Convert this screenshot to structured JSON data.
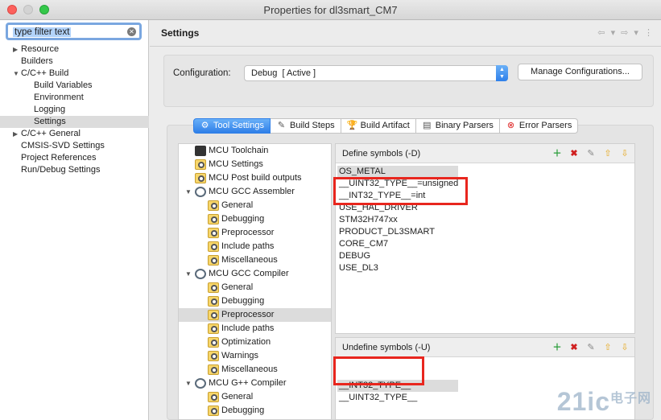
{
  "window": {
    "title": "Properties for dl3smart_CM7"
  },
  "filter": {
    "text": "type filter text"
  },
  "nav": [
    {
      "label": "Resource",
      "indent": 1,
      "arrow": "right"
    },
    {
      "label": "Builders",
      "indent": 1,
      "arrow": ""
    },
    {
      "label": "C/C++ Build",
      "indent": 1,
      "arrow": "down"
    },
    {
      "label": "Build Variables",
      "indent": 2,
      "arrow": ""
    },
    {
      "label": "Environment",
      "indent": 2,
      "arrow": ""
    },
    {
      "label": "Logging",
      "indent": 2,
      "arrow": ""
    },
    {
      "label": "Settings",
      "indent": 2,
      "arrow": "",
      "selected": true
    },
    {
      "label": "C/C++ General",
      "indent": 1,
      "arrow": "right"
    },
    {
      "label": "CMSIS-SVD Settings",
      "indent": 1,
      "arrow": ""
    },
    {
      "label": "Project References",
      "indent": 1,
      "arrow": ""
    },
    {
      "label": "Run/Debug Settings",
      "indent": 1,
      "arrow": ""
    }
  ],
  "header": {
    "title": "Settings"
  },
  "config": {
    "label": "Configuration:",
    "value": "Debug  [ Active ]",
    "manage_label": "Manage Configurations..."
  },
  "tabs": [
    {
      "label": "Tool Settings",
      "icon": "tool-settings-icon",
      "active": true
    },
    {
      "label": "Build Steps",
      "icon": "build-steps-icon"
    },
    {
      "label": "Build Artifact",
      "icon": "build-artifact-icon"
    },
    {
      "label": "Binary Parsers",
      "icon": "binary-parsers-icon"
    },
    {
      "label": "Error Parsers",
      "icon": "error-parsers-icon"
    }
  ],
  "tree": [
    {
      "label": "MCU Toolchain",
      "level": 0,
      "icon": "chip"
    },
    {
      "label": "MCU Settings",
      "level": 0,
      "icon": "folder-gear"
    },
    {
      "label": "MCU Post build outputs",
      "level": 0,
      "icon": "folder-gear"
    },
    {
      "label": "MCU GCC Assembler",
      "level": 0,
      "icon": "gear",
      "expanded": true
    },
    {
      "label": "General",
      "level": 1,
      "icon": "folder-gear"
    },
    {
      "label": "Debugging",
      "level": 1,
      "icon": "folder-gear"
    },
    {
      "label": "Preprocessor",
      "level": 1,
      "icon": "folder-gear"
    },
    {
      "label": "Include paths",
      "level": 1,
      "icon": "folder-gear"
    },
    {
      "label": "Miscellaneous",
      "level": 1,
      "icon": "folder-gear"
    },
    {
      "label": "MCU GCC Compiler",
      "level": 0,
      "icon": "gear",
      "expanded": true
    },
    {
      "label": "General",
      "level": 1,
      "icon": "folder-gear"
    },
    {
      "label": "Debugging",
      "level": 1,
      "icon": "folder-gear"
    },
    {
      "label": "Preprocessor",
      "level": 1,
      "icon": "folder-gear",
      "selected": true
    },
    {
      "label": "Include paths",
      "level": 1,
      "icon": "folder-gear"
    },
    {
      "label": "Optimization",
      "level": 1,
      "icon": "folder-gear"
    },
    {
      "label": "Warnings",
      "level": 1,
      "icon": "folder-gear"
    },
    {
      "label": "Miscellaneous",
      "level": 1,
      "icon": "folder-gear"
    },
    {
      "label": "MCU G++ Compiler",
      "level": 0,
      "icon": "gear",
      "expanded": true
    },
    {
      "label": "General",
      "level": 1,
      "icon": "folder-gear"
    },
    {
      "label": "Debugging",
      "level": 1,
      "icon": "folder-gear"
    }
  ],
  "define": {
    "title": "Define symbols (-D)",
    "symbols": [
      "OS_METAL",
      "__UINT32_TYPE__=unsigned",
      "__INT32_TYPE__=int",
      "USE_HAL_DRIVER",
      "STM32H747xx",
      "PRODUCT_DL3SMART",
      "CORE_CM7",
      "DEBUG",
      "USE_DL3"
    ]
  },
  "undefine": {
    "title": "Undefine symbols (-U)",
    "symbols": [
      "__INT32_TYPE__",
      "__UINT32_TYPE__"
    ]
  },
  "watermark": {
    "text": "21ic",
    "sub": "电子网"
  }
}
